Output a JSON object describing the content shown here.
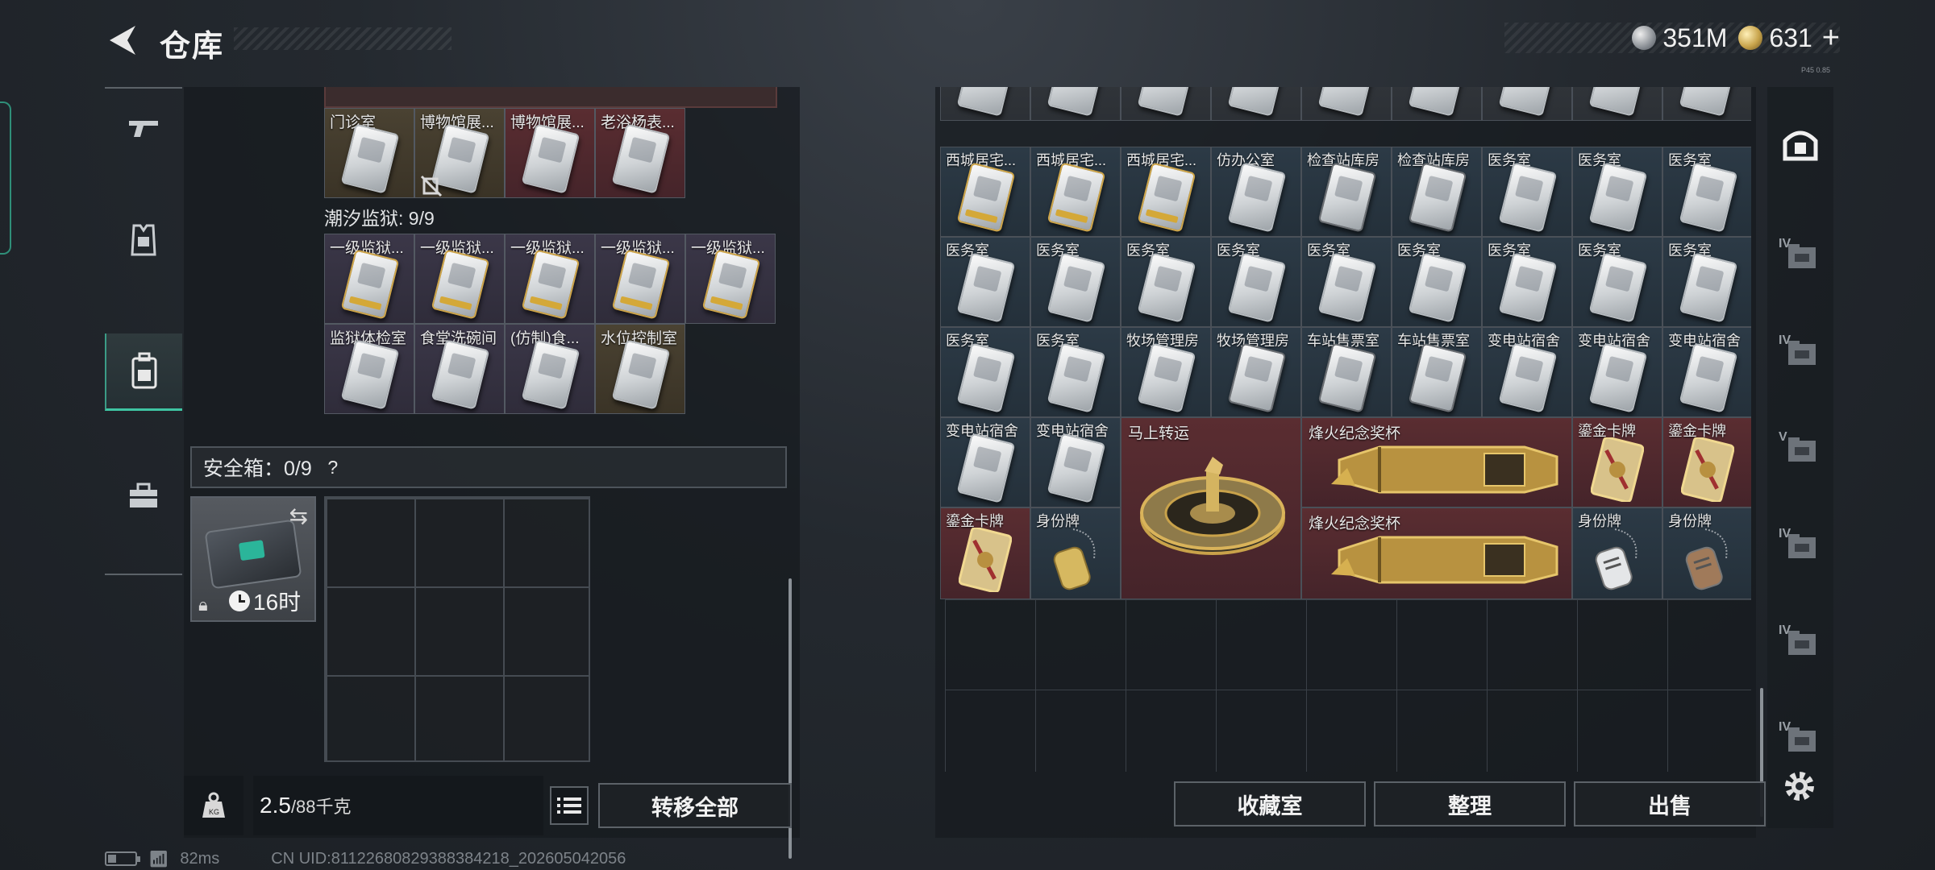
{
  "header": {
    "title": "仓库",
    "currency_silver": "351M",
    "currency_gold": "631",
    "currency_gold_suffix": "+",
    "version": "P45 0.85"
  },
  "left_nav": [
    "weapons-icon",
    "armor-icon",
    "backpack-icon",
    "toolbox-icon"
  ],
  "left_panel": {
    "top_group_items": [
      {
        "label": "门诊室",
        "bg": "gold",
        "card": "normal"
      },
      {
        "label": "博物馆展...",
        "bg": "gold",
        "card": "normal"
      },
      {
        "label": "博物馆展...",
        "bg": "red",
        "card": "normal"
      },
      {
        "label": "老浴杨表...",
        "bg": "red",
        "card": "normal"
      }
    ],
    "prison_title": "潮汐监狱: 9/9",
    "prison_items": [
      {
        "label": "一级监狱...",
        "bg": "purple",
        "card": "gold"
      },
      {
        "label": "一级监狱...",
        "bg": "purple",
        "card": "gold"
      },
      {
        "label": "一级监狱...",
        "bg": "purple",
        "card": "gold"
      },
      {
        "label": "一级监狱...",
        "bg": "purple",
        "card": "gold"
      },
      {
        "label": "一级监狱...",
        "bg": "purple",
        "card": "gold"
      },
      {
        "label": "监狱体检室",
        "bg": "purple",
        "card": "normal"
      },
      {
        "label": "食堂洗碗间",
        "bg": "purple",
        "card": "normal"
      },
      {
        "label": "(仿制)食...",
        "bg": "purple",
        "card": "normal"
      },
      {
        "label": "水位控制室",
        "bg": "gold",
        "card": "normal"
      }
    ],
    "safebox_title": "安全箱：0/9",
    "safebox_help": "?",
    "safebox_timer": "16时",
    "weight_current": "2.5",
    "weight_max": "/88千克",
    "transfer_all_label": "转移全部"
  },
  "right_panel": {
    "top_partial": [
      "",
      "",
      "",
      "",
      "",
      "",
      "",
      "",
      ""
    ],
    "rows": [
      [
        {
          "label": "西城居宅...",
          "bg": "blue",
          "card": "gold"
        },
        {
          "label": "西城居宅...",
          "bg": "blue",
          "card": "gold"
        },
        {
          "label": "西城居宅...",
          "bg": "blue",
          "card": "gold"
        },
        {
          "label": "仿办公室",
          "bg": "blue",
          "card": "normal"
        },
        {
          "label": "检查站库房",
          "bg": "blue",
          "card": "dark"
        },
        {
          "label": "检查站库房",
          "bg": "blue",
          "card": "dark"
        },
        {
          "label": "医务室",
          "bg": "blue",
          "card": "normal"
        },
        {
          "label": "医务室",
          "bg": "blue",
          "card": "normal"
        },
        {
          "label": "医务室",
          "bg": "blue",
          "card": "normal"
        }
      ],
      [
        {
          "label": "医务室",
          "bg": "blue",
          "card": "normal"
        },
        {
          "label": "医务室",
          "bg": "blue",
          "card": "normal"
        },
        {
          "label": "医务室",
          "bg": "blue",
          "card": "normal"
        },
        {
          "label": "医务室",
          "bg": "blue",
          "card": "normal"
        },
        {
          "label": "医务室",
          "bg": "blue",
          "card": "normal"
        },
        {
          "label": "医务室",
          "bg": "blue",
          "card": "normal"
        },
        {
          "label": "医务室",
          "bg": "blue",
          "card": "normal"
        },
        {
          "label": "医务室",
          "bg": "blue",
          "card": "normal"
        },
        {
          "label": "医务室",
          "bg": "blue",
          "card": "normal"
        }
      ],
      [
        {
          "label": "医务室",
          "bg": "blue",
          "card": "normal"
        },
        {
          "label": "医务室",
          "bg": "blue",
          "card": "normal"
        },
        {
          "label": "牧场管理房",
          "bg": "blue",
          "card": "normal"
        },
        {
          "label": "牧场管理房",
          "bg": "blue",
          "card": "dark"
        },
        {
          "label": "车站售票室",
          "bg": "blue",
          "card": "dark"
        },
        {
          "label": "车站售票室",
          "bg": "blue",
          "card": "dark"
        },
        {
          "label": "变电站宿舍",
          "bg": "blue",
          "card": "normal"
        },
        {
          "label": "变电站宿舍",
          "bg": "blue",
          "card": "normal"
        },
        {
          "label": "变电站宿舍",
          "bg": "blue",
          "card": "normal"
        }
      ]
    ],
    "row4_small": [
      {
        "label": "变电站宿舍",
        "bg": "blue",
        "card": "normal"
      },
      {
        "label": "变电站宿舍",
        "bg": "blue",
        "card": "normal"
      }
    ],
    "lucky_wheel_label": "马上转运",
    "trophy_label_1": "烽火纪念奖杯",
    "trophy_label_2": "烽火纪念奖杯",
    "row4_right": [
      {
        "label": "鎏金卡牌",
        "bg": "red"
      },
      {
        "label": "鎏金卡牌",
        "bg": "red"
      }
    ],
    "row5_left": [
      {
        "label": "鎏金卡牌",
        "bg": "red"
      },
      {
        "label": "身份牌",
        "bg": "blue"
      }
    ],
    "row5_right": [
      {
        "label": "身份牌",
        "bg": "blue"
      },
      {
        "label": "身份牌",
        "bg": "blue"
      }
    ],
    "collection_label": "收藏室",
    "sort_label": "整理",
    "sell_label": "出售"
  },
  "right_bar": [
    {
      "tier": "",
      "icon": "storage-home-icon"
    },
    {
      "tier": "IV",
      "icon": "storage-tab-1-icon"
    },
    {
      "tier": "IV",
      "icon": "storage-tab-2-icon"
    },
    {
      "tier": "V",
      "icon": "storage-tab-3-icon"
    },
    {
      "tier": "IV",
      "icon": "storage-tab-4-icon"
    },
    {
      "tier": "IV",
      "icon": "storage-tab-5-icon"
    },
    {
      "tier": "IV",
      "icon": "storage-tab-6-icon"
    }
  ],
  "status": {
    "ping": "82ms",
    "uid": "CN UID:811226808293883842​18_202605042056"
  },
  "colors": {
    "accent": "#3fc5a3",
    "gold_bg": "#4a4232",
    "red_bg": "#5a2d31",
    "blue_bg": "#2c3a46",
    "purple_bg": "#3b3748"
  }
}
